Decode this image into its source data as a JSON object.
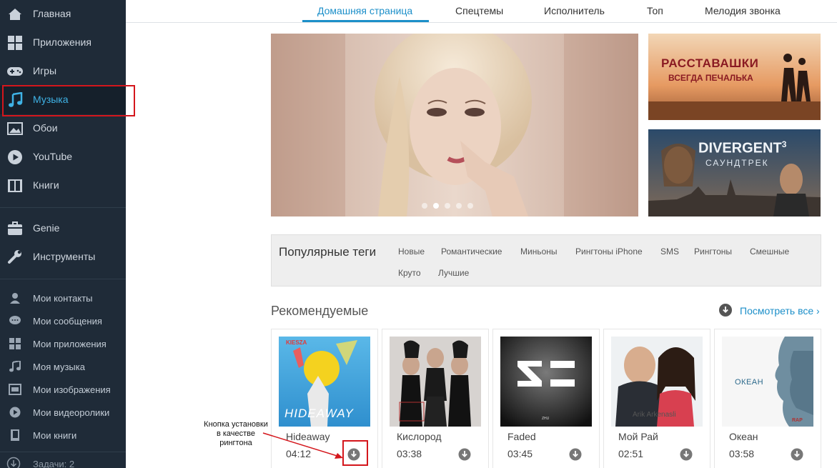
{
  "sidebar": {
    "main_items": [
      {
        "label": "Главная",
        "icon": "home-icon"
      },
      {
        "label": "Приложения",
        "icon": "apps-grid-icon"
      },
      {
        "label": "Игры",
        "icon": "gamepad-icon"
      },
      {
        "label": "Музыка",
        "icon": "music-note-icon",
        "active": true
      },
      {
        "label": "Обои",
        "icon": "wallpaper-icon"
      },
      {
        "label": "YouTube",
        "icon": "play-circle-icon"
      },
      {
        "label": "Книги",
        "icon": "book-icon"
      }
    ],
    "tool_items": [
      {
        "label": "Genie",
        "icon": "genie-icon"
      },
      {
        "label": "Инструменты",
        "icon": "wrench-icon"
      }
    ],
    "my_items": [
      {
        "label": "Мои контакты",
        "icon": "contact-icon"
      },
      {
        "label": "Мои сообщения",
        "icon": "message-icon"
      },
      {
        "label": "Мои приложения",
        "icon": "apps-grid-icon"
      },
      {
        "label": "Моя музыка",
        "icon": "music-note-icon"
      },
      {
        "label": "Мои изображения",
        "icon": "image-icon"
      },
      {
        "label": "Мои видеоролики",
        "icon": "video-icon"
      },
      {
        "label": "Мои книги",
        "icon": "book-icon"
      }
    ],
    "tasks_label": "Задачи: 2"
  },
  "tabs": [
    {
      "label": "Домашняя страница",
      "active": true
    },
    {
      "label": "Спецтемы"
    },
    {
      "label": "Исполнитель"
    },
    {
      "label": "Топ"
    },
    {
      "label": "Мелодия звонка"
    }
  ],
  "carousel": {
    "slide_count": 5,
    "active_index": 1
  },
  "banners": [
    {
      "text_line1": "РАССТАВАШКИ",
      "text_line2": "ВСЕГДА ПЕЧАЛЬКА"
    },
    {
      "text_line1": "DIVERGENT",
      "text_sup": "3",
      "text_line2": "САУНДТРЕК"
    }
  ],
  "tags": {
    "title": "Популярные теги",
    "items": [
      "Новые",
      "Романтические",
      "Миньоны",
      "Рингтоны iPhone",
      "SMS",
      "Рингтоны",
      "Смешные",
      "Круто",
      "Лучшие"
    ]
  },
  "recommended": {
    "title": "Рекомендуемые",
    "see_all": "Посмотреть все ›",
    "songs": [
      {
        "title": "Hideaway",
        "duration": "04:12",
        "cover_text": "HIDEAWAY",
        "cover_label": "KIESZA"
      },
      {
        "title": "Кислород",
        "duration": "03:38",
        "cover_text": "",
        "cover_label": ""
      },
      {
        "title": "Faded",
        "duration": "03:45",
        "cover_text": "ZHU",
        "cover_label": ""
      },
      {
        "title": "Мой Рай",
        "duration": "02:51",
        "cover_text": "Arik Arkenasli",
        "cover_label": ""
      },
      {
        "title": "Океан",
        "duration": "03:58",
        "cover_text": "ОКЕАН",
        "cover_label": "RAP"
      }
    ]
  },
  "annotation": {
    "line1": "Кнопка установки",
    "line2": "в качестве",
    "line3": "рингтона"
  },
  "colors": {
    "sidebar_bg": "#1f2b38",
    "accent": "#1c8fc9",
    "highlight_red": "#d4161c"
  }
}
